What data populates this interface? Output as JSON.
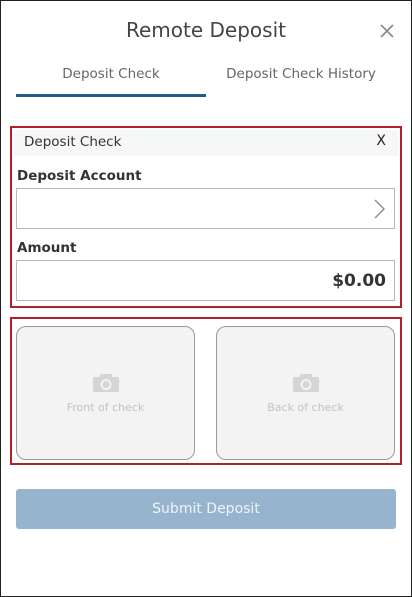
{
  "header": {
    "title": "Remote Deposit",
    "close_icon": "close-icon"
  },
  "tabs": [
    {
      "label": "Deposit Check",
      "active": true
    },
    {
      "label": "Deposit Check History",
      "active": false
    }
  ],
  "form": {
    "title": "Deposit Check",
    "close_label": "X",
    "deposit_account": {
      "label": "Deposit Account",
      "value": "",
      "icon": "chevron-right-icon"
    },
    "amount": {
      "label": "Amount",
      "value": "$0.00"
    }
  },
  "check_images": {
    "front": {
      "label": "Front of check",
      "icon": "camera-icon"
    },
    "back": {
      "label": "Back of check",
      "icon": "camera-icon"
    }
  },
  "submit": {
    "label": "Submit Deposit"
  },
  "colors": {
    "accent": "#1f5c8b",
    "highlight_border": "#b3202a",
    "submit_disabled": "#97b4cf"
  }
}
